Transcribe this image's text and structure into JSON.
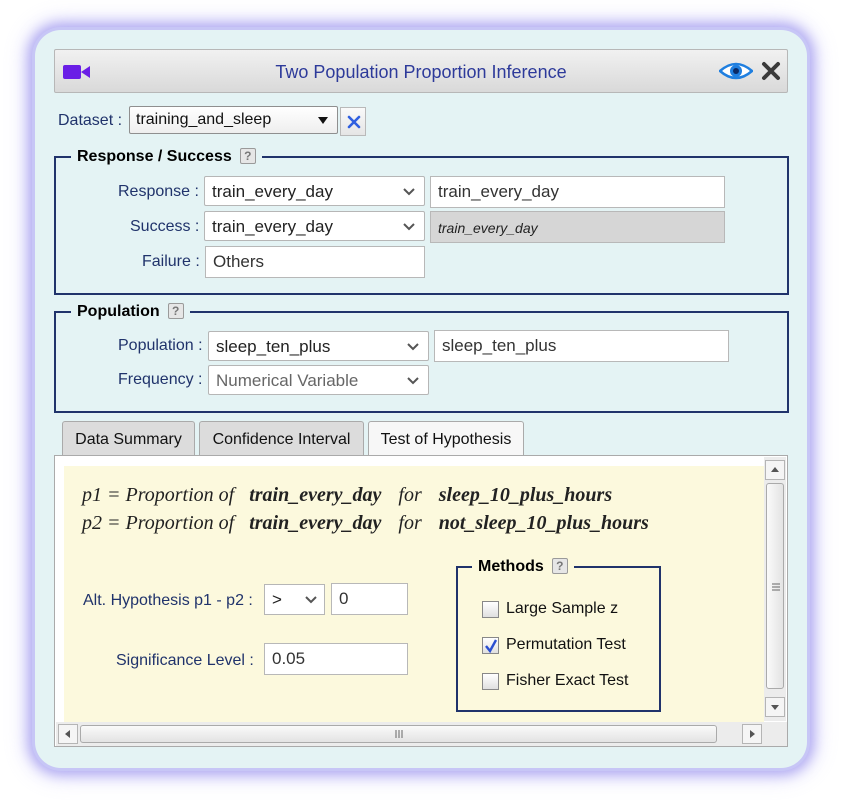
{
  "window": {
    "title": "Two Population Proportion Inference",
    "icons": [
      "video-camera-icon",
      "eye-icon",
      "close-icon"
    ]
  },
  "dataset": {
    "label": "Dataset :",
    "value": "training_and_sleep"
  },
  "response_section": {
    "legend": "Response / Success",
    "help": "?",
    "response_label": "Response :",
    "response_select": "train_every_day",
    "response_text": "train_every_day",
    "success_label": "Success :",
    "success_select": "train_every_day",
    "success_text": "train_every_day",
    "failure_label": "Failure :",
    "failure_value": "Others"
  },
  "population_section": {
    "legend": "Population",
    "help": "?",
    "population_label": "Population :",
    "population_select": "sleep_ten_plus",
    "population_text": "sleep_ten_plus",
    "frequency_label": "Frequency :",
    "frequency_select": "Numerical Variable"
  },
  "tabs": [
    {
      "label": "Data Summary",
      "active": false
    },
    {
      "label": "Confidence Interval",
      "active": false
    },
    {
      "label": "Test of Hypothesis",
      "active": true
    }
  ],
  "hypothesis": {
    "p1_prefix": "p1 = Proportion of",
    "p1_var": "train_every_day",
    "p1_for": "for",
    "p1_group": "sleep_10_plus_hours",
    "p2_prefix": "p2 = Proportion of",
    "p2_var": "train_every_day",
    "p2_for": "for",
    "p2_group": "not_sleep_10_plus_hours",
    "alt_label": "Alt. Hypothesis p1 - p2 :",
    "alt_operator": ">",
    "alt_value": "0",
    "sig_label": "Significance Level :",
    "sig_value": "0.05"
  },
  "methods": {
    "legend": "Methods",
    "help": "?",
    "items": [
      {
        "label": "Large Sample z",
        "checked": false
      },
      {
        "label": "Permutation Test",
        "checked": true
      },
      {
        "label": "Fisher Exact Test",
        "checked": false
      }
    ]
  },
  "colors": {
    "label_text": "#20336b",
    "title_text": "#2d3a9a",
    "panel_bg": "#fcf9dd",
    "frame_bg": "#e4f3f4",
    "camera": "#6a1ee6",
    "check": "#2a4fd0"
  }
}
